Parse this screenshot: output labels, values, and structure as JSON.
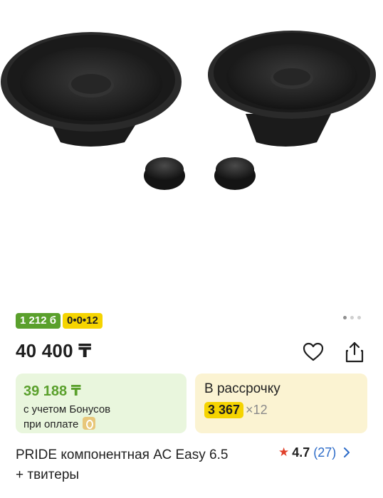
{
  "product": {
    "image_alt": "speakers-photo",
    "gallery_dots": 3,
    "gallery_active": 0
  },
  "badges": {
    "bonus": "1 212 б",
    "installment": "0•0•12"
  },
  "price": "40 400 ₸",
  "bonus_card": {
    "price": "39 188 ₸",
    "note_line1": "с учетом Бонусов",
    "note_line2": "при оплате"
  },
  "installment_card": {
    "title": "В рассрочку",
    "amount": "3 367",
    "multiplier": "×12"
  },
  "title_line1": "PRIDE компонентная АС Easy 6.5",
  "title_line2": "+ твитеры",
  "rating": {
    "value": "4.7",
    "count": "(27)"
  },
  "colors": {
    "bonus_green": "#5aa02c",
    "installment_yellow": "#f5d400",
    "link_blue": "#2c6bc8",
    "star_red": "#e0402a"
  }
}
